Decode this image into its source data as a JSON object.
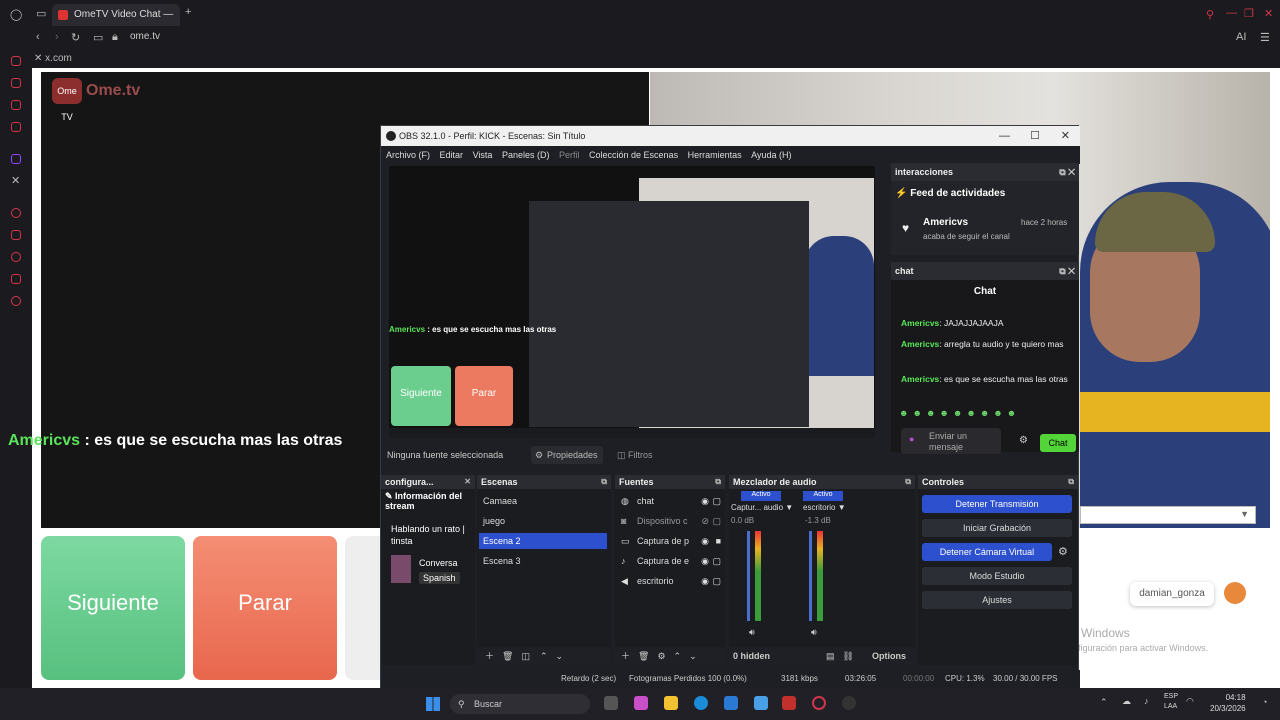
{
  "browser": {
    "tab_title": "OmeTV Video Chat — ",
    "url": "ome.tv",
    "bookmark": "x.com"
  },
  "page": {
    "logo_badge": "Ome TV",
    "logo_text": "Ome.tv",
    "chat_overlay": {
      "name": "Americvs",
      "text": " : es que se escucha mas las otras"
    },
    "btn_next": "Siguiente",
    "btn_stop": "Parar",
    "user_tag": "damian_gonza",
    "activate_title": "Activar Windows",
    "activate_sub": "Ve a Configuración para activar Windows."
  },
  "obs": {
    "title": "OBS 32.1.0 - Perfil: KICK - Escenas: Sin Título",
    "menu": [
      "Archivo (F)",
      "Editar",
      "Vista",
      "Paneles (D)",
      "Perfil",
      "Colección de Escenas",
      "Herramientas",
      "Ayuda (H)"
    ],
    "preview": {
      "btn_next": "Siguiente",
      "btn_stop": "Parar",
      "chat_name": "Americvs",
      "chat_text": " : es que se escucha mas las otras"
    },
    "no_source": "Ninguna fuente seleccionada",
    "tab_props": "Propiedades",
    "tab_filters": "Filtros",
    "interactions": {
      "header": "interacciones",
      "feed_title": "Feed de actividades",
      "feed_name": "Americvs",
      "feed_time": "hace 2 horas",
      "feed_msg": "acaba de seguir el canal"
    },
    "chat": {
      "header": "chat",
      "title": "Chat",
      "messages": [
        {
          "name": "Americvs",
          "text": ": JAJAJJAJAAJA"
        },
        {
          "name": "Americvs",
          "text": ": arregla tu audio y te quiero mas"
        },
        {
          "name": "Americvs",
          "text": ": es que se escucha mas las otras"
        }
      ],
      "input_placeholder": "Enviar un mensaje",
      "send": "Chat"
    },
    "docks": {
      "config": {
        "header": "configura...",
        "info": "Información del stream",
        "title": "Hablando un rato | tinsta",
        "category": "Conversa",
        "lang": "Spanish"
      },
      "scenes": {
        "header": "Escenas",
        "items": [
          "Camaea",
          "juego",
          "Escena 2",
          "Escena 3"
        ],
        "selected": 2
      },
      "sources": {
        "header": "Fuentes",
        "items": [
          "chat",
          "Dispositivo c",
          "Captura de p",
          "Captura de e",
          "escritorio"
        ]
      },
      "mixer": {
        "header": "Mezclador de audio",
        "ch1": {
          "state": "Activo",
          "name": "Captur... audio",
          "db": "0.0 dB"
        },
        "ch2": {
          "state": "Activo",
          "name": "escritorio",
          "db": "-1.3 dB"
        },
        "hidden": "0 hidden",
        "options": "Options"
      },
      "controls": {
        "header": "Controles",
        "buttons": [
          "Detener Transmisión",
          "Iniciar Grabación",
          "Detener Cámara Virtual",
          "Modo Estudio",
          "Ajustes"
        ]
      }
    },
    "status": {
      "delay": "Retardo (2 sec)",
      "dropped": "Fotogramas Perdidos 100 (0.0%)",
      "bitrate": "3181 kbps",
      "time": "03:26:05",
      "rec": "00:00:00",
      "cpu": "CPU: 1.3%",
      "fps": "30.00 / 30.00 FPS"
    }
  },
  "taskbar": {
    "search": "Buscar",
    "lang1": "ESP",
    "lang2": "LAA",
    "time": "04:18",
    "date": "20/3/2026"
  }
}
